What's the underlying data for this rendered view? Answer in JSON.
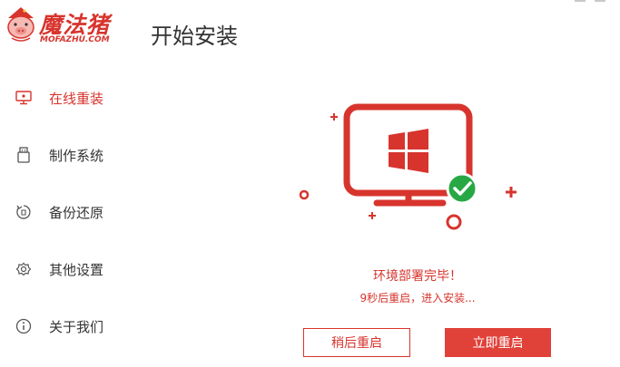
{
  "app": {
    "brand_name": "魔法猪",
    "brand_sub": "MOFAZHU.COM",
    "page_title": "开始安装"
  },
  "sidebar": {
    "items": [
      {
        "label": "在线重装",
        "icon": "monitor-icon",
        "active": true
      },
      {
        "label": "制作系统",
        "icon": "usb-drive-icon",
        "active": false
      },
      {
        "label": "备份还原",
        "icon": "backup-restore-icon",
        "active": false
      },
      {
        "label": "其他设置",
        "icon": "gear-icon",
        "active": false
      },
      {
        "label": "关于我们",
        "icon": "info-icon",
        "active": false
      }
    ]
  },
  "status": {
    "title": "环境部署完毕！",
    "message": "9秒后重启，进入安装..."
  },
  "actions": {
    "later_label": "稍后重启",
    "now_label": "立即重启"
  },
  "colors": {
    "accent": "#d7342d",
    "button_fill": "#e0423a",
    "success": "#27a844"
  }
}
